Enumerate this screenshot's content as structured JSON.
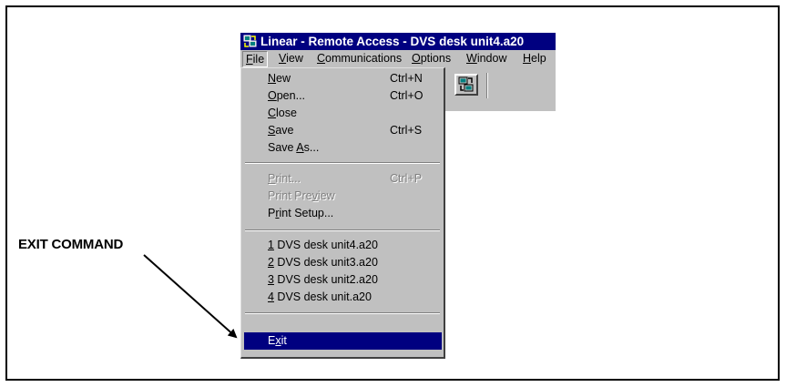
{
  "window": {
    "title": "Linear - Remote Access - DVS desk unit4.a20",
    "icon": "app-icon"
  },
  "menubar": {
    "items": [
      {
        "first": "F",
        "rest": "ile"
      },
      {
        "first": "V",
        "rest": "iew"
      },
      {
        "first": "C",
        "rest": "ommunications"
      },
      {
        "first": "O",
        "rest": "ptions"
      },
      {
        "first": "W",
        "rest": "indow"
      },
      {
        "first": "H",
        "rest": "elp"
      }
    ]
  },
  "toolbar": {
    "button_icon": "open-file-icon"
  },
  "file_menu": {
    "new": {
      "pre": "",
      "key": "N",
      "post": "ew",
      "shortcut": "Ctrl+N"
    },
    "open": {
      "pre": "",
      "key": "O",
      "post": "pen...",
      "shortcut": "Ctrl+O"
    },
    "close": {
      "pre": "",
      "key": "C",
      "post": "lose"
    },
    "save": {
      "pre": "",
      "key": "S",
      "post": "ave",
      "shortcut": "Ctrl+S"
    },
    "save_as": {
      "pre": "Save ",
      "key": "A",
      "post": "s..."
    },
    "print": {
      "pre": "",
      "key": "P",
      "post": "rint...",
      "shortcut": "Ctrl+P"
    },
    "print_preview": {
      "pre": "Print Pre",
      "key": "v",
      "post": "iew"
    },
    "print_setup": {
      "pre": "P",
      "key": "r",
      "post": "int Setup..."
    },
    "recent": [
      {
        "key": "1",
        "post": " DVS desk unit4.a20"
      },
      {
        "key": "2",
        "post": " DVS desk unit3.a20"
      },
      {
        "key": "3",
        "post": " DVS desk unit2.a20"
      },
      {
        "key": "4",
        "post": " DVS desk unit.a20"
      }
    ],
    "exit": {
      "pre": "E",
      "key": "x",
      "post": "it"
    }
  },
  "callout": {
    "label": "EXIT COMMAND"
  },
  "colors": {
    "titlebar": "#000080",
    "menu_face": "#c0c0c0",
    "highlight": "#000080",
    "disabled_text": "#808080"
  }
}
